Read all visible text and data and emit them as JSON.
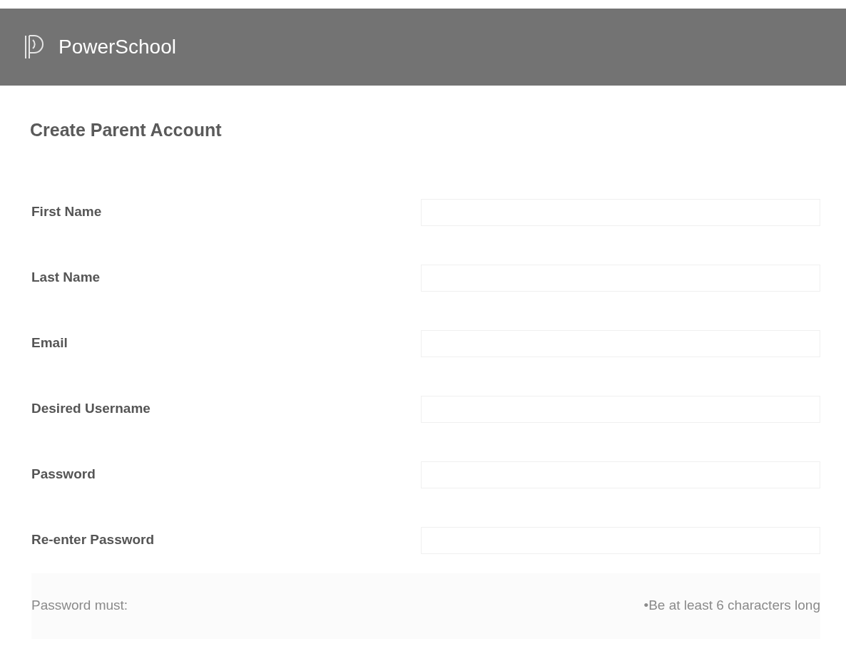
{
  "header": {
    "brand": "PowerSchool"
  },
  "page_title": "Create Parent Account",
  "fields": [
    {
      "label": "First Name"
    },
    {
      "label": "Last Name"
    },
    {
      "label": "Email"
    },
    {
      "label": "Desired Username"
    },
    {
      "label": "Password"
    },
    {
      "label": "Re-enter Password"
    }
  ],
  "password_rules": {
    "label": "Password must:",
    "rules": [
      "•Be at least 6 characters long"
    ]
  }
}
